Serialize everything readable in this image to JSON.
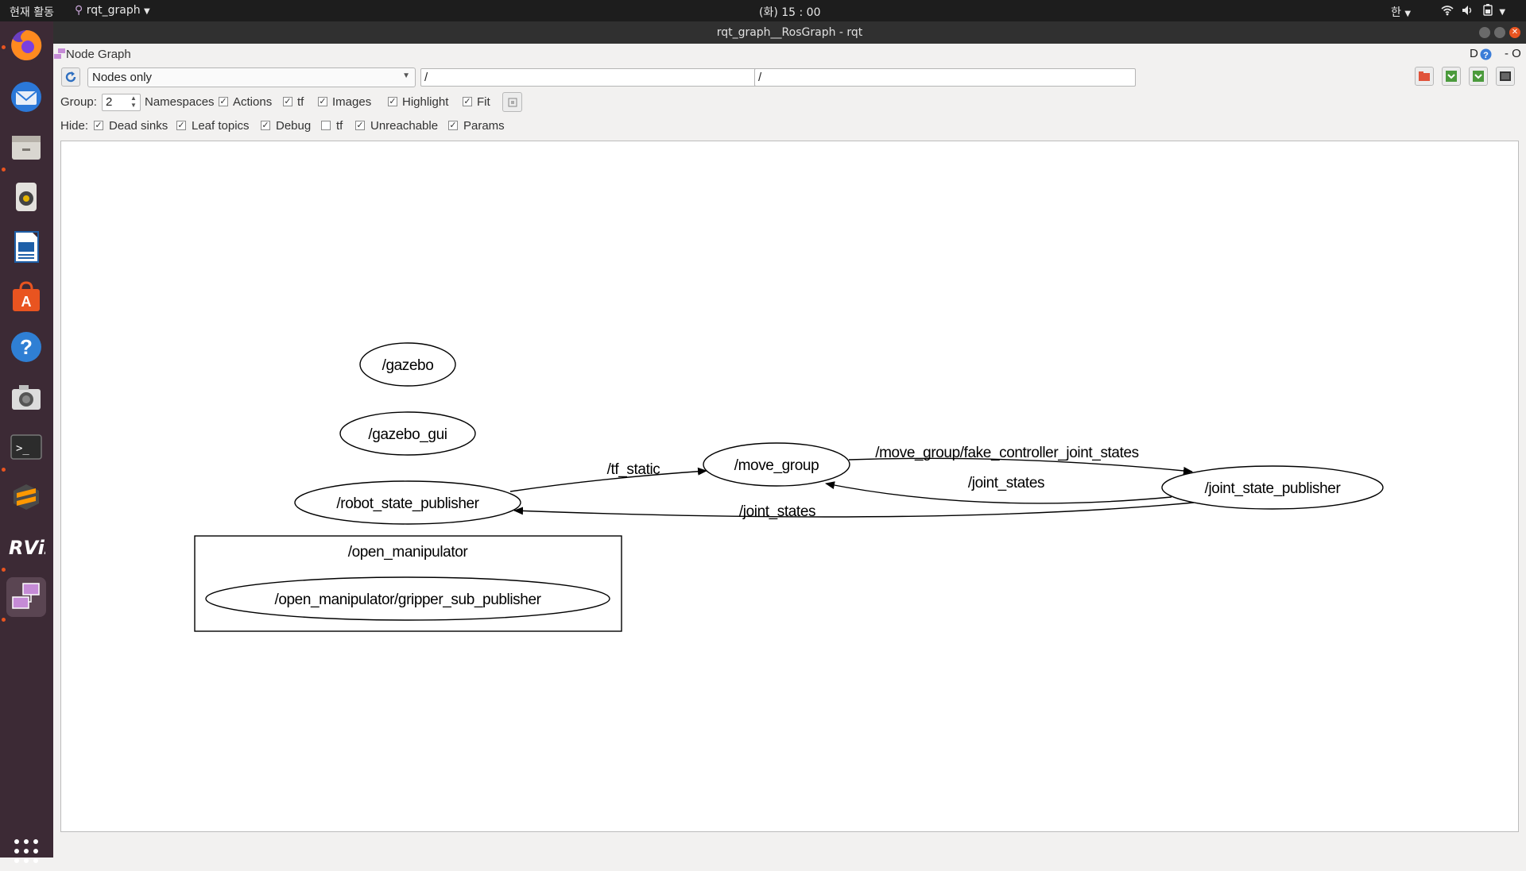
{
  "topbar": {
    "activities": "현재 활동",
    "app_name": "rqt_graph",
    "clock": "(화) 15 : 00",
    "input_method": "한"
  },
  "window": {
    "title": "rqt_graph__RosGraph - rqt"
  },
  "plugin": {
    "title": "Node Graph",
    "help_d": "D",
    "dash_o": "- O"
  },
  "toolbar": {
    "mode_value": "Nodes only",
    "filter_nodes_value": "/",
    "filter_topics_value": "/"
  },
  "options": {
    "group_label": "Group:",
    "group_value": "2",
    "namespaces_label": "Namespaces",
    "actions_label": "Actions",
    "tf_label": "tf",
    "images_label": "Images",
    "highlight_label": "Highlight",
    "fit_label": "Fit",
    "check_mark": "✓"
  },
  "hide": {
    "hide_label": "Hide:",
    "dead_sinks_label": "Dead sinks",
    "leaf_topics_label": "Leaf topics",
    "debug_label": "Debug",
    "tf_label": "tf",
    "unreachable_label": "Unreachable",
    "params_label": "Params"
  },
  "graph": {
    "nodes": {
      "gazebo": "/gazebo",
      "gazebo_gui": "/gazebo_gui",
      "robot_state_publisher": "/robot_state_publisher",
      "move_group": "/move_group",
      "joint_state_publisher": "/joint_state_publisher",
      "gripper_sub_publisher": "/open_manipulator/gripper_sub_publisher"
    },
    "cluster": "/open_manipulator",
    "edges": {
      "tf_static": "/tf_static",
      "fake_controller": "/move_group/fake_controller_joint_states",
      "joint_states_upper": "/joint_states",
      "joint_states_lower": "/joint_states"
    }
  },
  "colors": {
    "accent": "#e95420",
    "dock": "#3c2a35",
    "topbar": "#1d1d1d",
    "titlebar": "#303030"
  },
  "icons": {
    "dock": [
      "firefox-icon",
      "thunderbird-icon",
      "files-icon",
      "rhythmbox-icon",
      "writer-icon",
      "software-icon",
      "help-icon",
      "screenshot-icon",
      "terminal-icon",
      "sublime-icon",
      "rviz-icon",
      "rqt-icon",
      "apps-grid-icon"
    ]
  }
}
